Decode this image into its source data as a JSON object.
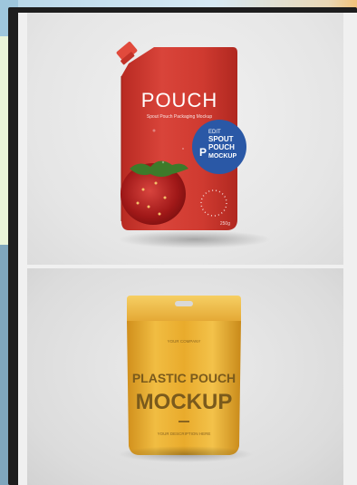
{
  "spout_pouch": {
    "brand": "POUCH",
    "tagline": "Spout Pouch Packaging Mockup",
    "badge_line1": "EDIT",
    "badge_line2": "SPOUT",
    "badge_line3": "POUCH",
    "badge_line4": "MOCKUP",
    "badge_logo": "P",
    "weight": "250g",
    "colors": {
      "pouch": "#d23a2e",
      "badge": "#2a58a6"
    }
  },
  "zip_pouch": {
    "company": "YOUR COMPANY",
    "title_line1": "PLASTIC POUCH",
    "title_line2": "MOCKUP",
    "footer": "YOUR DESCRIPTION HERE",
    "colors": {
      "pouch": "#e8a92b",
      "text": "#7a5a1c"
    }
  }
}
